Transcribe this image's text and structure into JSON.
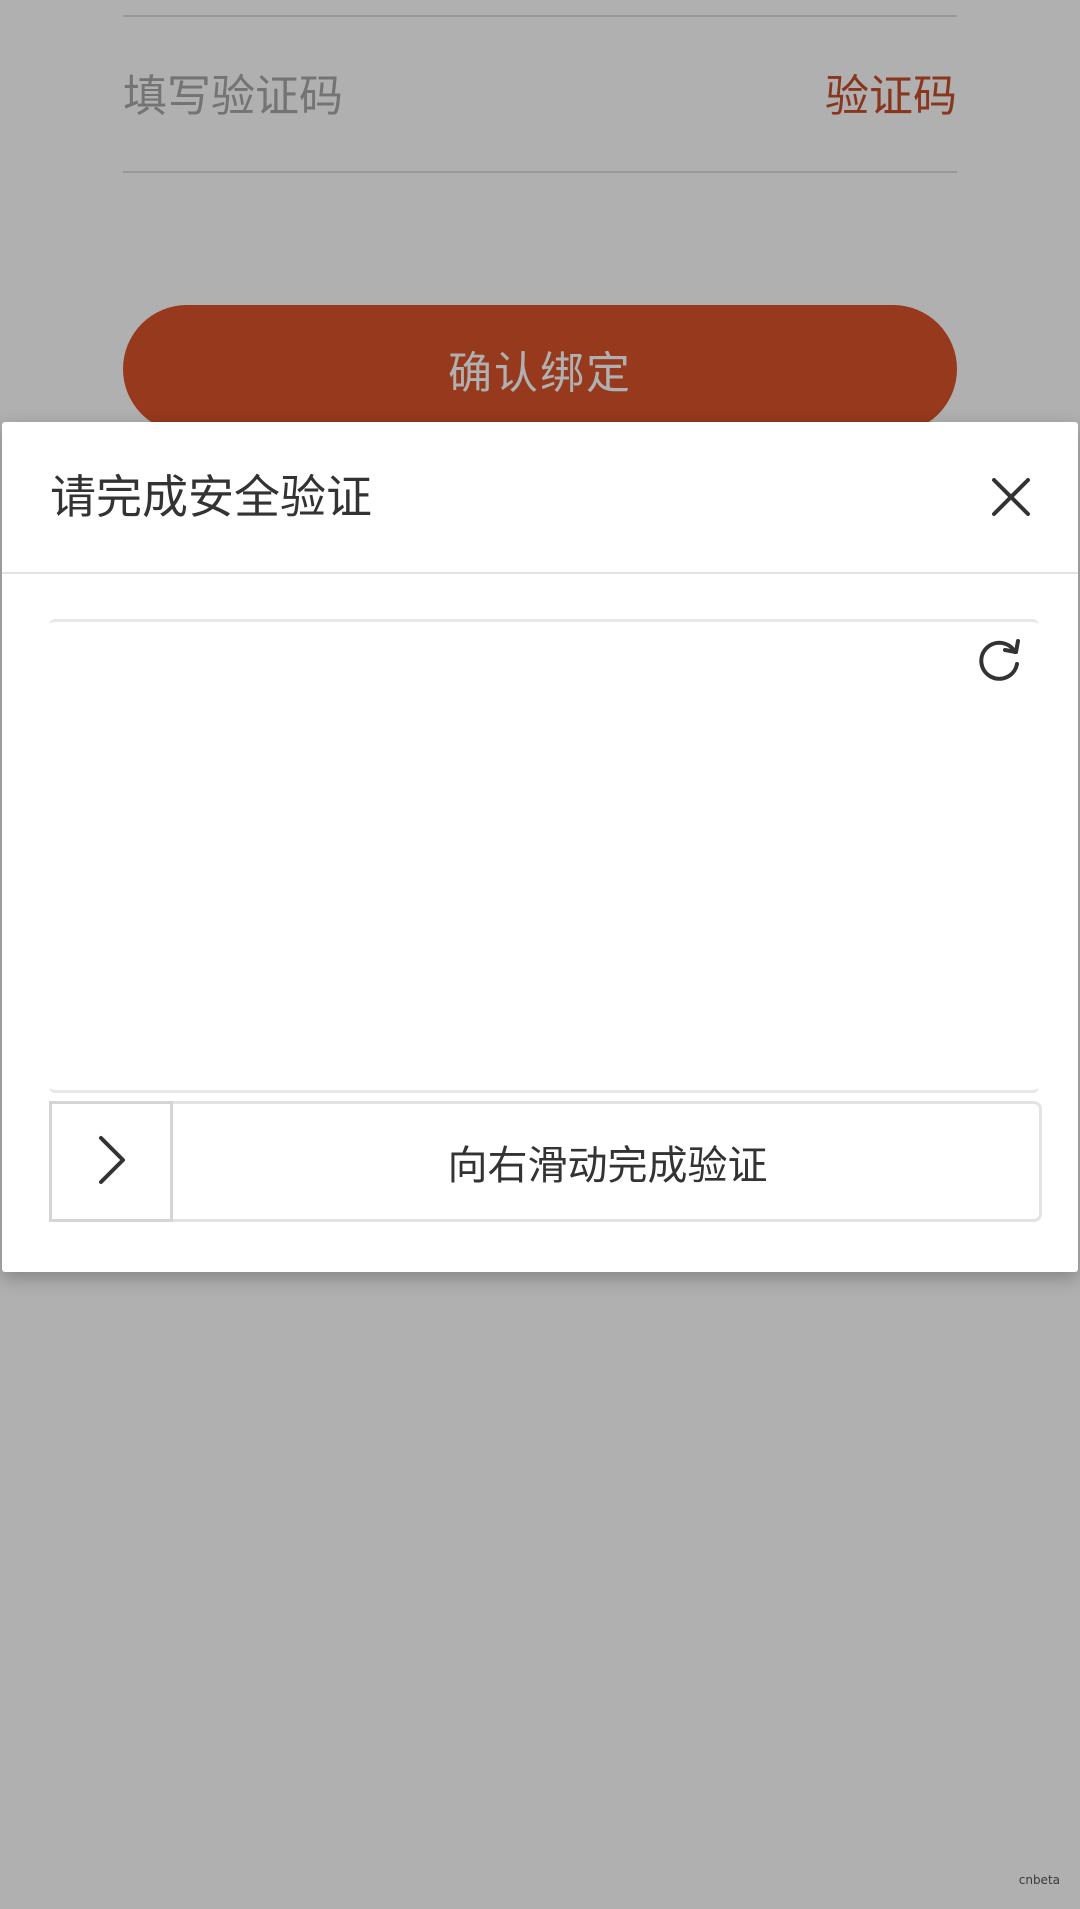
{
  "background_form": {
    "code_input_placeholder": "填写验证码",
    "get_code_label": "验证码",
    "confirm_label": "确认绑定"
  },
  "dialog": {
    "title": "请完成安全验证",
    "close_icon": "close-icon",
    "refresh_icon": "refresh-icon",
    "slider_hint": "向右滑动完成验证",
    "slider_handle_icon": "chevron-right-icon"
  },
  "watermark": "cnbeta",
  "colors": {
    "accent": "#d9532b",
    "accent_text": "#c84f2e",
    "overlay": "rgba(0,0,0,0.31)"
  }
}
